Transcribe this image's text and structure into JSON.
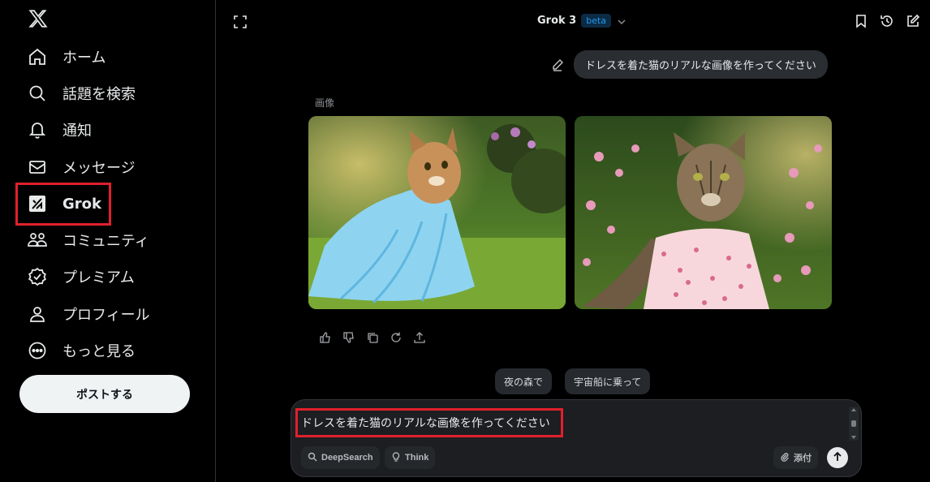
{
  "sidebar": {
    "logo": "x-logo",
    "items": [
      {
        "label": "ホーム",
        "icon": "home-icon"
      },
      {
        "label": "話題を検索",
        "icon": "search-icon"
      },
      {
        "label": "通知",
        "icon": "bell-icon"
      },
      {
        "label": "メッセージ",
        "icon": "mail-icon"
      },
      {
        "label": "Grok",
        "icon": "grok-icon",
        "active": true
      },
      {
        "label": "コミュニティ",
        "icon": "community-icon"
      },
      {
        "label": "プレミアム",
        "icon": "verified-icon"
      },
      {
        "label": "プロフィール",
        "icon": "profile-icon"
      },
      {
        "label": "もっと見る",
        "icon": "more-icon"
      }
    ],
    "post_button": "ポストする"
  },
  "header": {
    "model_name": "Grok 3",
    "badge": "beta"
  },
  "chat": {
    "user_message": "ドレスを着た猫のリアルな画像を作ってください",
    "images_label": "画像",
    "images": [
      {
        "description": "cat-in-blue-dress"
      },
      {
        "description": "cat-in-floral-dress"
      }
    ]
  },
  "suggestions": [
    "夜の森で",
    "宇宙船に乗って"
  ],
  "composer": {
    "value": "ドレスを着た猫のリアルな画像を作ってください",
    "deepsearch": "DeepSearch",
    "think": "Think",
    "attach": "添付"
  },
  "colors": {
    "background": "#000000",
    "highlight": "#e0202c",
    "beta": "#1d9bf0"
  }
}
